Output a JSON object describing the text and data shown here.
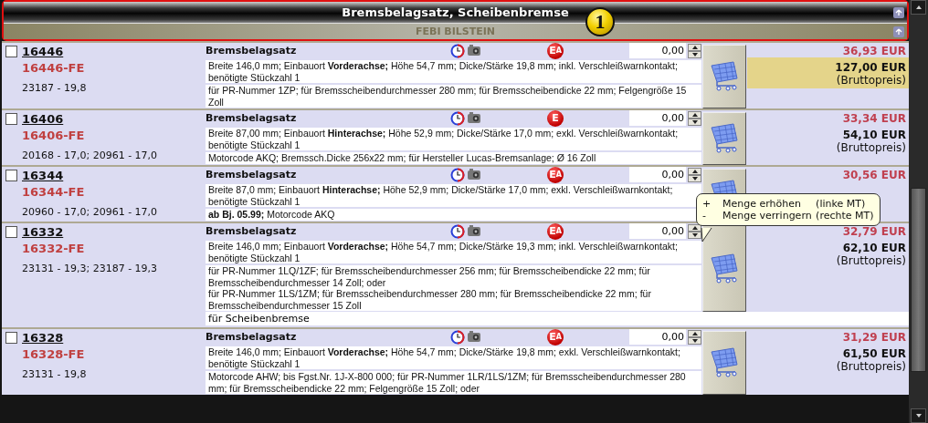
{
  "header": {
    "title": "Bremsbelagsatz, Scheibenbremse",
    "brand": "FEBI BILSTEIN",
    "badge": "1"
  },
  "rows": [
    {
      "checked": false,
      "article": "16446",
      "code": "16446-FE",
      "refs": "23187 - 19,8",
      "title": "Bremsbelagsatz",
      "badge": {
        "letter": "E",
        "sub": "A"
      },
      "quantity": "0,00",
      "descriptions": [
        [
          "Breite 146,0 mm; Einbauort **Vorderachse;** Höhe 54,7 mm; Dicke/Stärke 19,8 mm; inkl. Verschleißwarnkontakt; benötigte Stückzahl 1"
        ],
        [
          "für PR-Nummer 1ZP; für Bremsscheibendurchmesser 280 mm; für Bremsscheibendicke 22 mm; Felgengröße 15 Zoll"
        ]
      ],
      "price": "36,93 EUR",
      "gross_price": "127,00 EUR",
      "gross_note": "(Bruttopreis)",
      "highlighted": true
    },
    {
      "checked": false,
      "article": "16406",
      "code": "16406-FE",
      "refs": "20168 - 17,0; 20961 - 17,0",
      "title": "Bremsbelagsatz",
      "badge": {
        "letter": "E"
      },
      "quantity": "0,00",
      "descriptions": [
        [
          "Breite 87,00 mm; Einbauort **Hinterachse;** Höhe 52,9 mm; Dicke/Stärke 17,0 mm; exkl. Verschleißwarnkontakt; benötigte Stückzahl 1"
        ],
        [
          "Motorcode AKQ; Bremssch.Dicke 256x22 mm; für Hersteller Lucas-Bremsanlage; Ø 16 Zoll"
        ]
      ],
      "price": "33,34 EUR",
      "gross_price": "54,10 EUR",
      "gross_note": "(Bruttopreis)",
      "highlighted": false
    },
    {
      "checked": false,
      "article": "16344",
      "code": "16344-FE",
      "refs": "20960 - 17,0; 20961 - 17,0",
      "title": "Bremsbelagsatz",
      "badge": {
        "letter": "E",
        "sub": "A"
      },
      "quantity": "0,00",
      "descriptions": [
        [
          "Breite 87,0 mm; Einbauort **Hinterachse;** Höhe 52,9 mm; Dicke/Stärke 17,0 mm; exkl. Verschleißwarnkontakt; benötigte Stückzahl 1"
        ],
        [
          "**ab Bj. 05.99;** Motorcode AKQ"
        ]
      ],
      "price": "30,56 EUR"
    },
    {
      "checked": false,
      "article": "16332",
      "code": "16332-FE",
      "refs": "23131 - 19,3; 23187 - 19,3",
      "title": "Bremsbelagsatz",
      "badge": {
        "letter": "E",
        "sub": "A"
      },
      "quantity": "0,00",
      "descriptions": [
        [
          "Breite 146,0 mm; Einbauort **Vorderachse;** Höhe 54,7 mm; Dicke/Stärke 19,3 mm; inkl. Verschleißwarnkontakt; benötigte Stückzahl 1"
        ],
        [
          "für PR-Nummer 1LQ/1ZF; für Bremsscheibendurchmesser 256 mm; für Bremsscheibendicke 22 mm; für Bremsscheibendurchmesser 14 Zoll; oder",
          "für PR-Nummer 1LS/1ZM; für Bremsscheibendurchmesser 280 mm; für Bremsscheibendicke 22 mm; für Bremsscheibendurchmesser 15 Zoll"
        ]
      ],
      "note": "für Scheibenbremse",
      "price": "32,79 EUR",
      "gross_price": "62,10 EUR",
      "gross_note": "(Bruttopreis)",
      "highlighted": false
    },
    {
      "checked": false,
      "article": "16328",
      "code": "16328-FE",
      "refs": "23131 - 19,8",
      "title": "Bremsbelagsatz",
      "badge": {
        "letter": "E",
        "sub": "A"
      },
      "quantity": "0,00",
      "descriptions": [
        [
          "Breite 146,0 mm; Einbauort **Vorderachse;** Höhe 54,7 mm; Dicke/Stärke 19,8 mm; exkl. Verschleißwarnkontakt; benötigte Stückzahl 1"
        ],
        [
          "Motorcode AHW; bis Fgst.Nr. 1J-X-800 000; für PR-Nummer 1LR/1LS/1ZM; für Bremsscheibendurchmesser 280 mm; für Bremsscheibendicke 22 mm; Felgengröße 15 Zoll; oder"
        ]
      ],
      "price": "31,29 EUR",
      "gross_price": "61,50 EUR",
      "gross_note": "(Bruttopreis)",
      "highlighted": false
    }
  ],
  "tooltip": {
    "lines": [
      {
        "sign": "+",
        "label": "Menge erhöhen",
        "hint": "(linke MT)"
      },
      {
        "sign": "-",
        "label": "Menge verringern",
        "hint": "(rechte MT)"
      }
    ]
  }
}
